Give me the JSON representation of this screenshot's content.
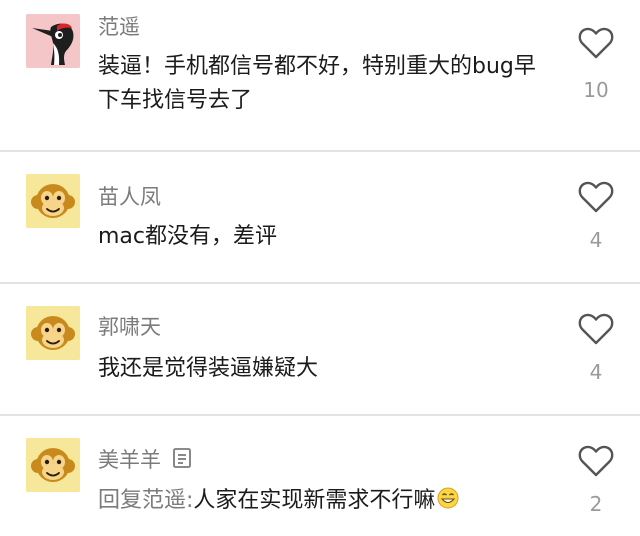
{
  "comments": [
    {
      "avatar_icon": "woodpecker-icon",
      "username": "范遥",
      "text": "装逼！手机都信号都不好，特别重大的bug早下车找信号去了",
      "like_count": "10",
      "like_icon": "heart-outline-icon"
    },
    {
      "avatar_icon": "monkey-face-icon",
      "username": "苗人凤",
      "text": "mac都没有，差评",
      "like_count": "4",
      "like_icon": "heart-outline-icon"
    },
    {
      "avatar_icon": "monkey-face-icon",
      "username": "郭啸天",
      "text": "我还是觉得装逼嫌疑大",
      "like_count": "4",
      "like_icon": "heart-outline-icon"
    },
    {
      "avatar_icon": "monkey-face-icon",
      "username": "美羊羊",
      "username_badge_icon": "detail-doc-icon",
      "reply_prefix": "回复范遥:",
      "text": "人家在实现新需求不行嘛",
      "emoji_icon": "grin-emoji-icon",
      "like_count": "2",
      "like_icon": "heart-outline-icon"
    }
  ],
  "colors": {
    "username": "#7b7b7b",
    "body_text": "#1b1b1b",
    "like_count": "#9a9a9a",
    "divider": "#e3e3e3",
    "avatar_pink_bg": "#f4c6c8",
    "avatar_yellow_bg": "#f7e79a"
  }
}
